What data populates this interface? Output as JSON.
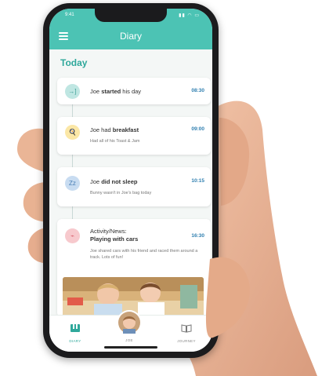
{
  "status": {
    "time": "9:41",
    "icons": "▮▮ ◠ ▭"
  },
  "header": {
    "title": "Diary"
  },
  "section": {
    "title": "Today"
  },
  "entries": [
    {
      "title_prefix": "Joe ",
      "title_bold": "started",
      "title_suffix": " his day",
      "time": "08:30",
      "desc": "",
      "icon": "sign-in-icon",
      "color": "#bfe6e2"
    },
    {
      "title_prefix": "Joe had ",
      "title_bold": "breakfast",
      "title_suffix": "",
      "time": "09:00",
      "desc": "Had all of his Toast & Jam",
      "icon": "food-icon",
      "color": "#fbe7a6"
    },
    {
      "title_prefix": "Joe ",
      "title_bold": "did not sleep",
      "title_suffix": "",
      "time": "10:15",
      "desc": "Bunny wasn't in Joe's bag today",
      "icon": "sleep-icon",
      "color": "#c8dcf1"
    },
    {
      "title_prefix": "Activity/News:",
      "title_bold": "Playing with cars",
      "title_suffix": "",
      "time": "16:30",
      "desc": "Joe shared cars with his friend and raced them around a track. Lots of fun!",
      "icon": "activity-icon",
      "color": "#f7c9cd"
    }
  ],
  "nav": [
    {
      "label": "DIARY",
      "icon": "diary-icon",
      "active": true
    },
    {
      "label": "JOE",
      "icon": "child-avatar",
      "active": false
    },
    {
      "label": "JOURNEY",
      "icon": "book-icon",
      "active": false
    }
  ],
  "colors": {
    "accent": "#4cc3b4",
    "time": "#2f7fb0",
    "active_nav": "#2fa89b"
  }
}
